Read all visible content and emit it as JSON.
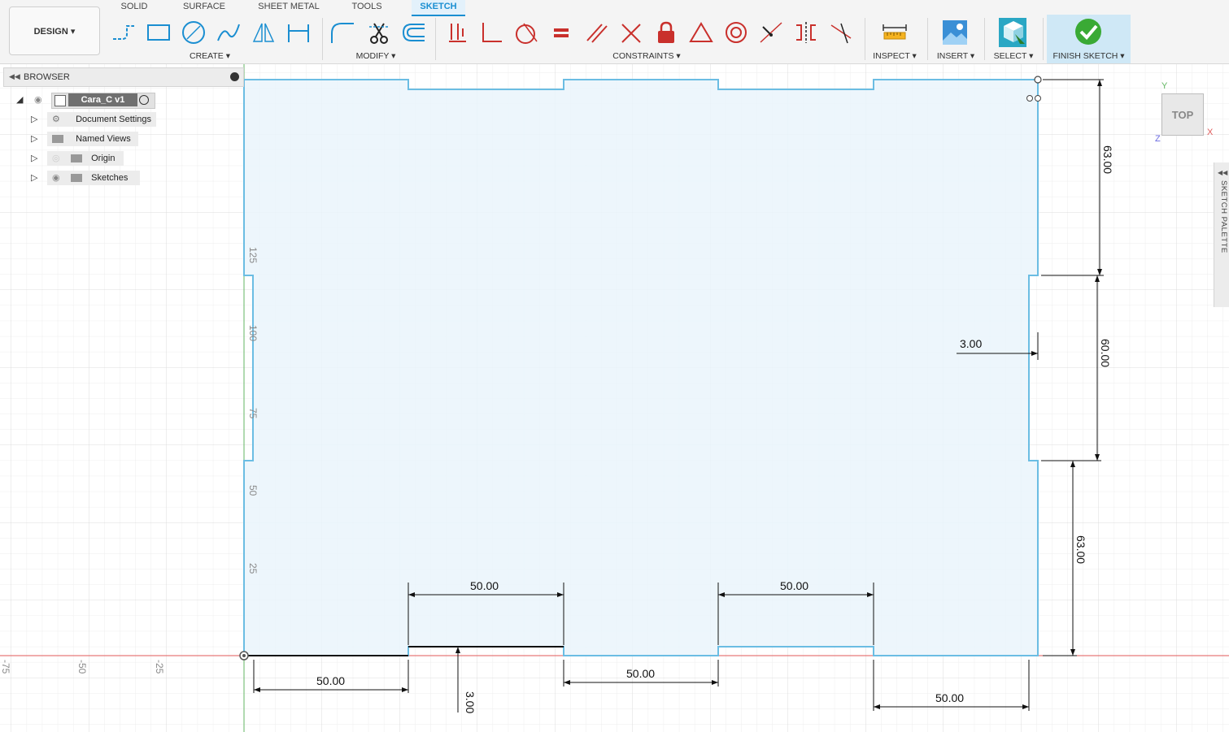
{
  "design_menu": {
    "label": "DESIGN ▾"
  },
  "tabs": [
    {
      "label": "SOLID"
    },
    {
      "label": "SURFACE"
    },
    {
      "label": "SHEET METAL"
    },
    {
      "label": "TOOLS"
    },
    {
      "label": "SKETCH"
    }
  ],
  "groups": {
    "create": "CREATE ▾",
    "modify": "MODIFY ▾",
    "constraints": "CONSTRAINTS ▾",
    "inspect": "INSPECT ▾",
    "insert": "INSERT ▾",
    "select": "SELECT ▾",
    "finish": "FINISH SKETCH ▾"
  },
  "browser": {
    "title": "BROWSER",
    "root": "Cara_C v1",
    "items": [
      {
        "label": "Document Settings",
        "icon": "gear-icon"
      },
      {
        "label": "Named Views",
        "icon": "folder-icon"
      },
      {
        "label": "Origin",
        "icon": "folder-icon"
      },
      {
        "label": "Sketches",
        "icon": "folder-icon"
      }
    ]
  },
  "viewcube": {
    "face": "TOP",
    "axis_x": "X",
    "axis_y": "Y",
    "axis_z": "Z"
  },
  "sketch_palette": {
    "label": "SKETCH PALETTE"
  },
  "axis_ticks": {
    "vertical": [
      "125",
      "100",
      "75",
      "50",
      "25"
    ],
    "horizontal": [
      "-75",
      "-50",
      "-25"
    ]
  },
  "dimensions": {
    "top_tab_width_1": "50.00",
    "top_tab_width_2": "50.00",
    "notch_depth_bottom": "3.00",
    "bottom_left_gap": "50.00",
    "bottom_mid_gap": "50.00",
    "bottom_right_gap": "50.00",
    "right_top_height": "63.00",
    "right_mid_height": "60.00",
    "right_bottom_height": "63.00",
    "right_notch_depth": "3.00"
  },
  "colors": {
    "accent": "#1a8ed1",
    "sketch_fill": "#eaf4fb",
    "sketch_line": "#6bbde3",
    "x_axis": "#e05a5a",
    "y_axis": "#63b663",
    "constraint_red": "#c9302c"
  }
}
